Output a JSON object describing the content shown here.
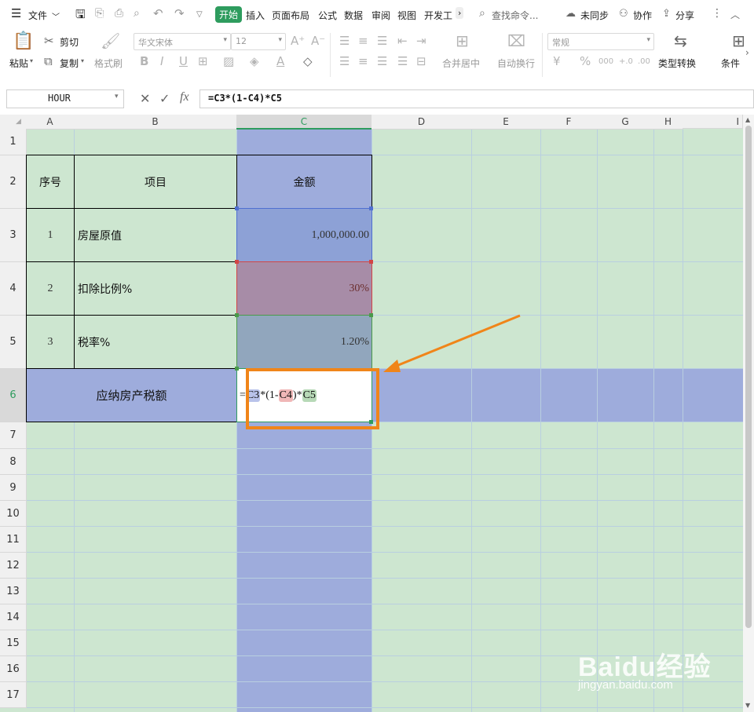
{
  "menubar": {
    "file_label": "文件",
    "tabs": [
      "开始",
      "插入",
      "页面布局",
      "公式",
      "数据",
      "审阅",
      "视图",
      "开发工"
    ],
    "active_tab": "开始",
    "search_placeholder": "查找命令...",
    "sync_label": "未同步",
    "collab_label": "协作",
    "share_label": "分享"
  },
  "ribbon": {
    "paste_label": "粘贴",
    "cut_label": "剪切",
    "copy_label": "复制",
    "format_painter_label": "格式刷",
    "font_name": "华文宋体",
    "font_size": "12",
    "merge_center_label": "合并居中",
    "wrap_text_label": "自动换行",
    "number_format": "常规",
    "type_convert_label": "类型转换",
    "conditional_label": "条件"
  },
  "formula_bar": {
    "name_box": "HOUR",
    "fx_label": "fx",
    "formula": "=C3*(1-C4)*C5"
  },
  "columns": [
    "A",
    "B",
    "C",
    "D",
    "E",
    "F",
    "G",
    "H",
    "I"
  ],
  "rows": [
    "1",
    "2",
    "3",
    "4",
    "5",
    "6",
    "7",
    "8",
    "9",
    "10",
    "11",
    "12",
    "13",
    "14",
    "15",
    "16",
    "17"
  ],
  "table": {
    "header": {
      "seq": "序号",
      "item": "项目",
      "amount": "金额"
    },
    "rows": [
      {
        "seq": "1",
        "item": "房屋原值",
        "amount": "1,000,000.00"
      },
      {
        "seq": "2",
        "item": "扣除比例%",
        "amount": "30%"
      },
      {
        "seq": "3",
        "item": "税率%",
        "amount": "1.20%"
      }
    ],
    "total_label": "应纳房产税额",
    "editing_formula": {
      "eq": "=",
      "ref1": "C3",
      "op1": "*(1-",
      "ref2": "C4",
      "op2": ")*",
      "ref3": "C5"
    }
  },
  "watermark": {
    "brand": "Baidu经验",
    "url": "jingyan.baidu.com"
  },
  "colors": {
    "sheet_bg": "#cde6d0",
    "column_c_fill": "#9eacdc",
    "row6_fill": "#9eacdc",
    "c3_fill": "#8da1d6",
    "c4_fill": "#a78ca7",
    "c5_fill": "#91a6bd",
    "annotation_orange": "#f08519",
    "active_tab_green": "#2e9c5e"
  }
}
